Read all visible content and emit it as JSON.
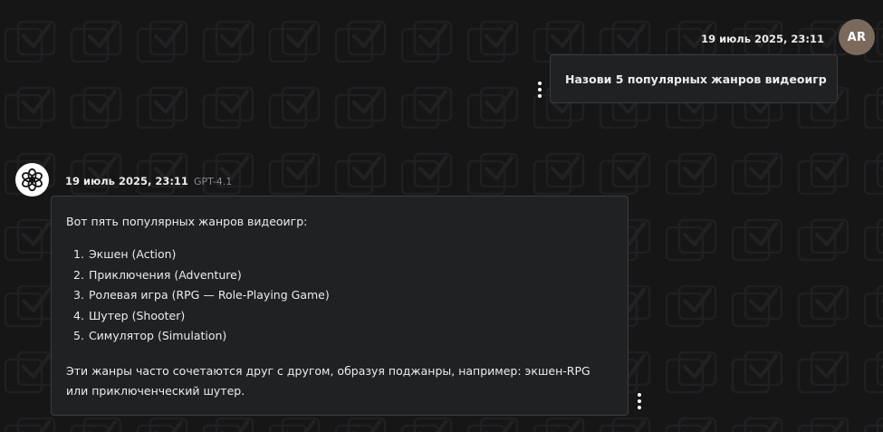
{
  "user_message": {
    "avatar_initials": "AR",
    "timestamp": "19 июль 2025, 23:11",
    "text": "Назови 5 популярных жанров видеоигр"
  },
  "assistant_message": {
    "timestamp": "19 июль 2025, 23:11",
    "model": "GPT-4.1",
    "intro": "Вот пять популярных жанров видеоигр:",
    "items": [
      {
        "num": "1.",
        "text": "Экшен (Action)"
      },
      {
        "num": "2.",
        "text": "Приключения (Adventure)"
      },
      {
        "num": "3.",
        "text": "Ролевая игра (RPG — Role-Playing Game)"
      },
      {
        "num": "4.",
        "text": "Шутер (Shooter)"
      },
      {
        "num": "5.",
        "text": "Симулятор (Simulation)"
      }
    ],
    "outro": "Эти жанры часто сочетаются друг с другом, образуя поджанры, например: экшен-RPG или приключенческий шутер."
  },
  "icons": {
    "assistant_avatar": "openai-logo-icon",
    "message_menu": "kebab-menu-icon",
    "background": "checkbox-pattern"
  },
  "colors": {
    "background": "#161617",
    "bubble": "#202123",
    "bubble_border": "#3c3d40",
    "user_avatar": "#7b6a5c",
    "text": "#ececec",
    "muted": "#8a8a8e"
  }
}
